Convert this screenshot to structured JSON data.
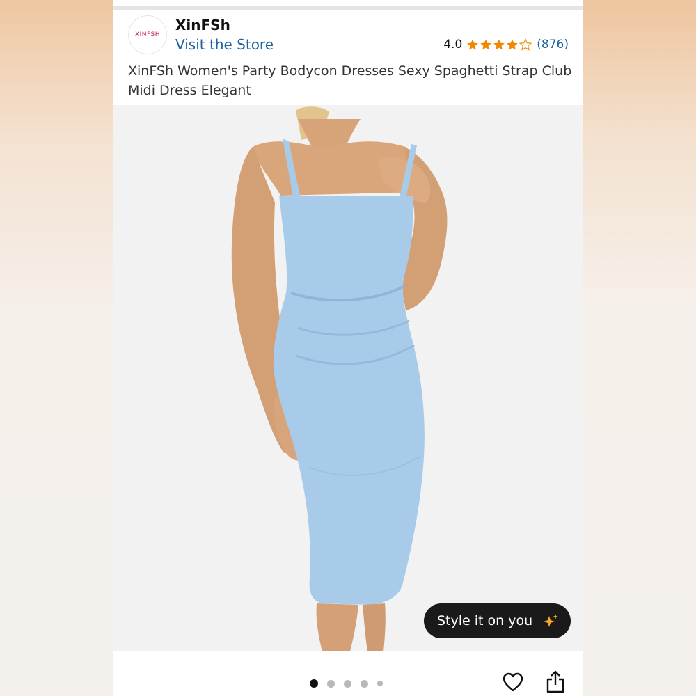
{
  "store": {
    "logo_text": "XINFSH",
    "name": "XinFSh",
    "visit_link": "Visit the Store"
  },
  "rating": {
    "value": "4.0",
    "stars": 4,
    "max_stars": 5,
    "count": "(876)",
    "star_color": "#f08804"
  },
  "product": {
    "title": "XinFSh Women's Party Bodycon Dresses Sexy Spaghetti Strap Club Midi Dress Elegant",
    "dress_color": "#a8cbea"
  },
  "style_button": {
    "label": "Style it on you",
    "icon": "sparkle-icon"
  },
  "carousel": {
    "total_dots": 5,
    "active_index": 0
  },
  "actions": {
    "favorite_icon": "heart-icon",
    "share_icon": "share-icon"
  }
}
